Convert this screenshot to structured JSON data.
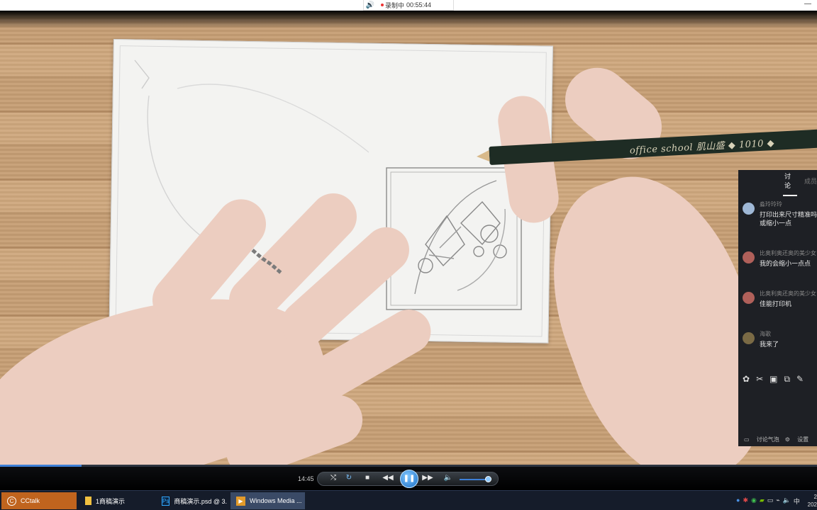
{
  "recorder": {
    "status_label": "录制中",
    "elapsed": "00:55:44",
    "minimize_label": "—"
  },
  "scene": {
    "pencil_brand": "office school 肌山盛 ◆ 1010 ◆"
  },
  "chat": {
    "tabs": {
      "discuss": "讨论",
      "members": "成员"
    },
    "messages": [
      {
        "name": "淼玲玲玲",
        "lines": [
          "打印出来尺寸精准吗,",
          "或缩小一点"
        ],
        "avatar_color": "#9fb8d6"
      },
      {
        "name": "比奥利奥还奥的美少女",
        "lines": [
          "我的会缩小一点点"
        ],
        "avatar_color": "#b0605a"
      },
      {
        "name": "比奥利奥还奥的美少女",
        "lines": [
          "佳能打印机"
        ],
        "avatar_color": "#b0605a"
      },
      {
        "name": "海歌",
        "lines": [
          "我来了"
        ],
        "avatar_color": "#7a6a45"
      }
    ],
    "footer": {
      "bubble_label": "讨论气泡",
      "settings_label": "设置"
    }
  },
  "player": {
    "time": "14:45",
    "progress_fraction": 0.1
  },
  "taskbar": {
    "items": [
      {
        "label": "CCtalk"
      },
      {
        "label": "1商稿演示"
      },
      {
        "label": "商稿演示.psd @ 3..."
      },
      {
        "label": "Windows Media ..."
      }
    ],
    "ime": "中",
    "clock": [
      "2",
      "202"
    ]
  },
  "colors": {
    "accent": "#3d7fd6",
    "cctalk_orange": "#c0641e",
    "chat_bg": "#1e2025"
  }
}
